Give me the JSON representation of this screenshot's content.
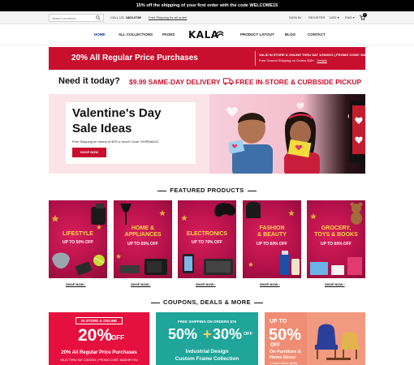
{
  "announcement": "15% off the shipping of your first order with the code WELCOME15",
  "utility": {
    "search_placeholder": "Search products...",
    "call_label": "CALL US:",
    "call_number": "1800-6789",
    "free_shipping": "Free Shipping for all order!",
    "sign_in": "SIGN IN",
    "register": "REGISTER",
    "currency": "USD",
    "language": "ENG",
    "cart_count": "0"
  },
  "nav": {
    "items": [
      "HOME",
      "ALL COLLECTIONS",
      "PAGES",
      "PRODUCT LAYOUT",
      "BLOG",
      "CONTACT"
    ],
    "logo": "KALA"
  },
  "promo": {
    "headline": "20% All Regular Price Purchases",
    "line1": "VALID IN STORE & ONLINE THRU SAT 1/30/2021  |  PROMO CODE: MADEBYYOU",
    "line2": "Free Ground Shipping on Orders $35+",
    "details": "Details"
  },
  "need_today": {
    "question": "Need it today?",
    "same_day": "$9.99 SAME-DAY DELIVERY",
    "pickup": "FREE IN-STORE & CURBSIDE PICKUP"
  },
  "hero": {
    "title_line1": "Valentine's Day",
    "title_line2": "Sale Ideas",
    "subtitle": "Free Shipping on orders of $75 or more! Code: SHIPMAGIC",
    "button": "SHOP NOW"
  },
  "featured": {
    "title": "FEATURED PRODUCTS",
    "tiles": [
      {
        "title": "LIFESTYLE",
        "sub": "UP TO 50% OFF",
        "shop": "SHOP NOW ›"
      },
      {
        "title": "HOME &",
        "title2": "APPLIANCES",
        "sub": "UP TO 65% OFF",
        "shop": "SHOP NOW ›"
      },
      {
        "title": "ELECTRONICS",
        "sub": "UP TO 70% OFF",
        "shop": "SHOP NOW ›"
      },
      {
        "title": "FASHION",
        "title2": "& BEAUTY",
        "sub": "UP TO 60% OFF",
        "shop": "SHOP NOW ›"
      },
      {
        "title": "GROCERY,",
        "title2": "TOYS & BOOKS",
        "sub": "UP TO 65% OFF",
        "shop": "SHOP NOW ›"
      }
    ]
  },
  "coupons": {
    "title": "COUPONS, DEALS & MORE",
    "c1": {
      "tag": "IN STORE & ONLINE",
      "big": "20%",
      "off": "OFF",
      "line": "20% All Regular Price Purchases",
      "small": "VALID THRU SAT 1/30/2021  |  PROMO CODE: MADEBYYOU"
    },
    "c2": {
      "top": "FREE SHIPPING ON ORDERS $75",
      "big1": "50%",
      "plus": "+",
      "big2": "30%",
      "off": "OFF",
      "line1": "Industrial Design",
      "line2": "Custom Frame Collection"
    },
    "c3": {
      "up": "UP TO",
      "big": "50%",
      "off": "OFF",
      "line1": "On Furniture &",
      "line2": "Home Decor",
      "more": "+ more home deals"
    }
  },
  "colors": {
    "brand_red": "#c8102e",
    "nav_active": "#0a2f8f",
    "tile_yellow": "#fbd44a",
    "teal": "#1fa59a",
    "salmon": "#ef8e74"
  }
}
